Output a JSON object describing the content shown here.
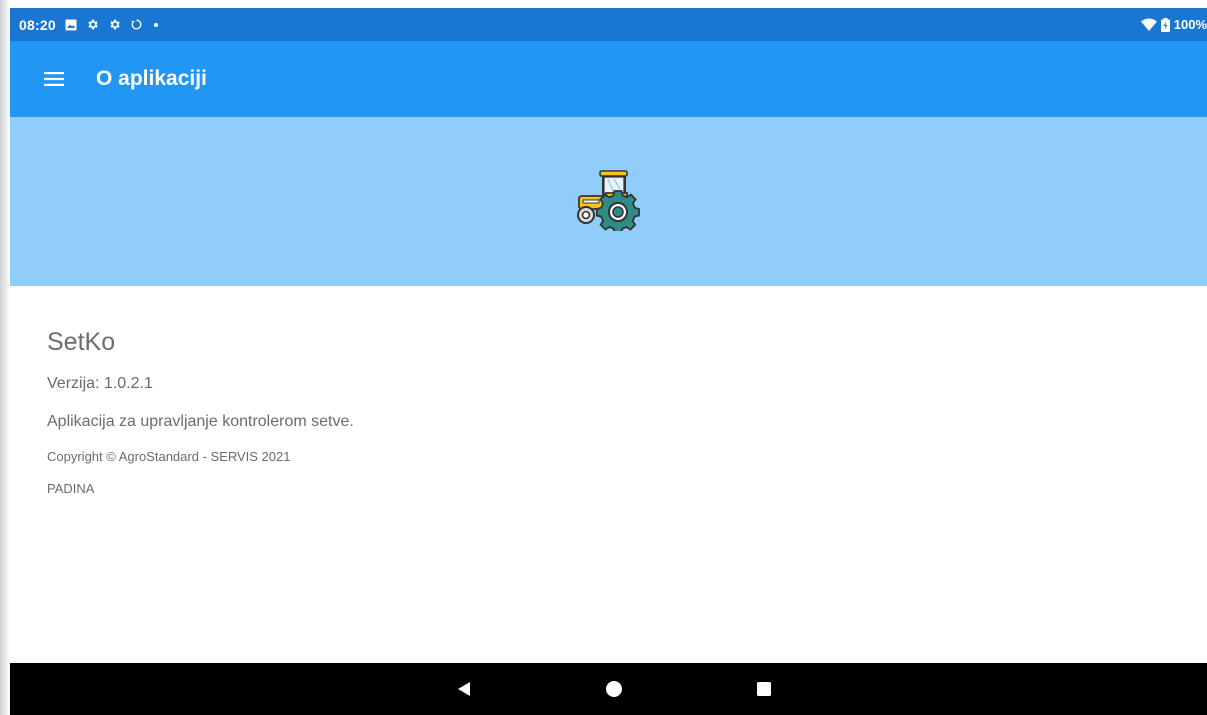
{
  "status_bar": {
    "time": "08:20",
    "battery": "100%",
    "icons": [
      "image-icon",
      "settings-icon",
      "settings-icon",
      "sync-icon",
      "dot-icon",
      "wifi-icon",
      "battery-icon"
    ]
  },
  "toolbar": {
    "menu_icon": "hamburger-menu-icon",
    "title": "O aplikaciji"
  },
  "banner": {
    "logo": "tractor-gear-logo"
  },
  "about": {
    "app_name": "SetKo",
    "version": "Verzija: 1.0.2.1",
    "description": "Aplikacija za upravljanje kontrolerom setve.",
    "copyright": "Copyright © AgroStandard - SERVIS 2021",
    "location": "PADINA"
  },
  "nav_bar": {
    "buttons": [
      "back-icon",
      "home-icon",
      "recents-icon"
    ]
  },
  "colors": {
    "status_bar": "#1976d2",
    "toolbar": "#2196f3",
    "banner": "#90cdfb",
    "text": "#6b6b6b",
    "nav_bar": "#000000"
  }
}
